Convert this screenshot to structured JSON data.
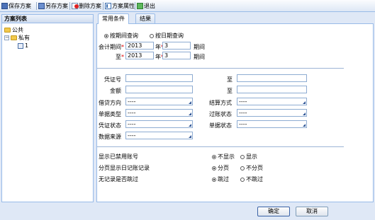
{
  "toolbar": {
    "save": "保存方案",
    "save_as": "另存方案",
    "delete": "删除方案",
    "properties": "方案属性",
    "exit": "退出"
  },
  "left_panel": {
    "title": "方案列表",
    "tree": [
      {
        "label": "公共",
        "type": "folder"
      },
      {
        "label": "私有",
        "type": "folder"
      },
      {
        "label": "1",
        "type": "item"
      }
    ]
  },
  "tabs": [
    {
      "label": "常用条件",
      "active": true
    },
    {
      "label": "结果",
      "active": false
    }
  ],
  "query_mode": {
    "by_period": {
      "label": "按期间查询",
      "selected": true
    },
    "by_date": {
      "label": "按日期查询",
      "selected": false
    }
  },
  "period": {
    "from_label": "会计期间",
    "to_label": "至",
    "year_label": "年",
    "period_label": "期间",
    "from_year": "2013",
    "from_period": "3",
    "to_year": "2013",
    "to_period": "3"
  },
  "fields": {
    "voucher_no": {
      "label": "凭证号",
      "value": ""
    },
    "voucher_no_to": {
      "label": "至",
      "value": ""
    },
    "amount": {
      "label": "金额",
      "value": ""
    },
    "amount_to": {
      "label": "至",
      "value": ""
    },
    "dc_direction": {
      "label": "借贷方向",
      "value": "----"
    },
    "settle_method": {
      "label": "结算方式",
      "value": "----"
    },
    "doc_type": {
      "label": "单据类型",
      "value": "----"
    },
    "posting_status": {
      "label": "过账状态",
      "value": "----"
    },
    "voucher_status": {
      "label": "凭证状态",
      "value": "----"
    },
    "doc_status": {
      "label": "单据状态",
      "value": "----"
    },
    "data_source": {
      "label": "数据来源",
      "value": "----"
    }
  },
  "options": {
    "show_disabled": {
      "label": "显示已禁用账号",
      "opt1": "不显示",
      "opt2": "显示",
      "selected": 1
    },
    "page_per_journal": {
      "label": "分页显示日记账记录",
      "opt1": "分页",
      "opt2": "不分页",
      "selected": 1
    },
    "skip_no_record": {
      "label": "无记录是否跳过",
      "opt1": "跳过",
      "opt2": "不跳过",
      "selected": 1
    }
  },
  "buttons": {
    "ok": "确定",
    "cancel": "取消"
  }
}
